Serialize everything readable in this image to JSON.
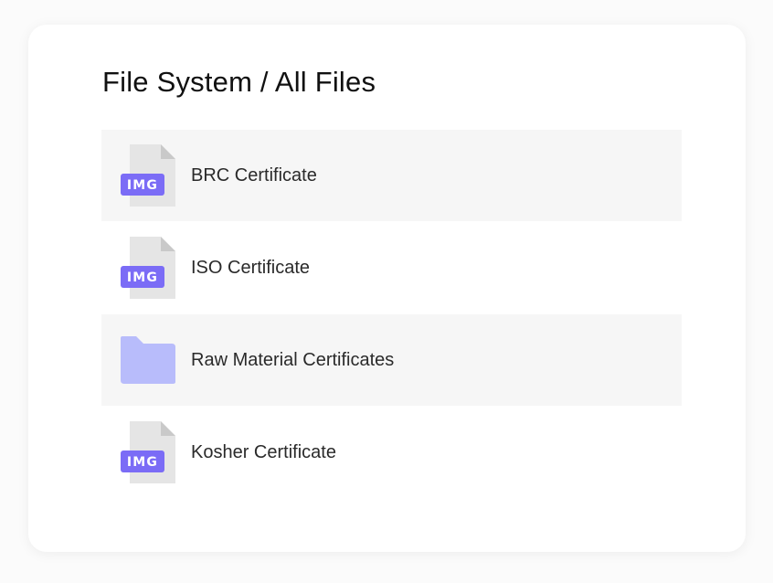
{
  "breadcrumb": {
    "title": "File System / All Files"
  },
  "items": [
    {
      "label": "BRC Certificate",
      "type": "image",
      "badge": "IMG",
      "icon": "image-file-icon"
    },
    {
      "label": "ISO Certificate",
      "type": "image",
      "badge": "IMG",
      "icon": "image-file-icon"
    },
    {
      "label": "Raw Material Certificates",
      "type": "folder",
      "icon": "folder-icon"
    },
    {
      "label": "Kosher Certificate",
      "type": "image",
      "badge": "IMG",
      "icon": "image-file-icon"
    }
  ],
  "colors": {
    "accent": "#7b6cf6",
    "folder": "#b8bcfb",
    "file_body": "#e5e5e5",
    "file_fold": "#c9c9c9",
    "row_shaded": "#f6f6f6"
  }
}
